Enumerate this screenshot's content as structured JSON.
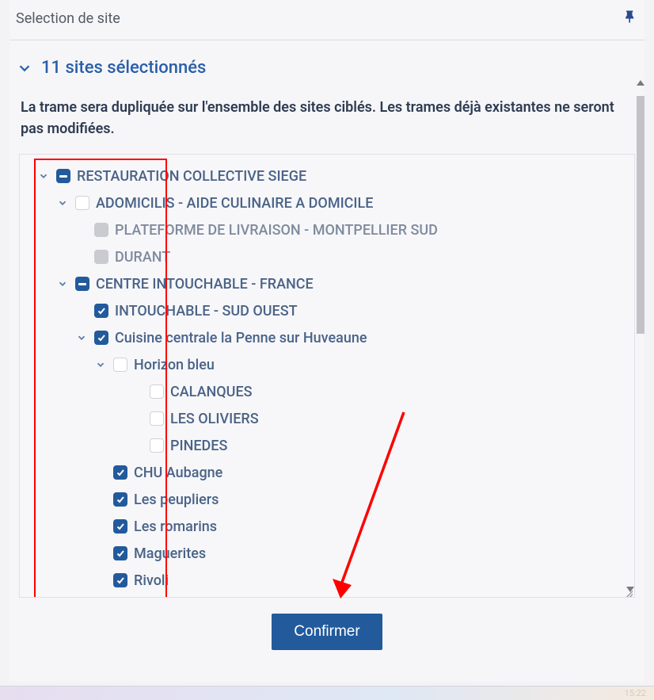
{
  "header": {
    "title": "Selection de site"
  },
  "summary": "11 sites sélectionnés",
  "description": "La trame sera dupliquée sur l'ensemble des sites ciblés. Les trames déjà existantes ne seront pas modifiées.",
  "tree": {
    "root": {
      "label": "RESTAURATION COLLECTIVE SIEGE",
      "a": {
        "label": "ADOMICILIS - AIDE CULINAIRE A DOMICILE"
      },
      "a1": {
        "label": "PLATEFORME DE LIVRAISON - MONTPELLIER SUD"
      },
      "a2": {
        "label": "DURANT"
      },
      "b": {
        "label": "CENTRE INTOUCHABLE - FRANCE"
      },
      "b1": {
        "label": "INTOUCHABLE - SUD OUEST"
      },
      "b2": {
        "label": "Cuisine centrale la Penne sur Huveaune"
      },
      "b2a": {
        "label": "Horizon bleu"
      },
      "b2a1": {
        "label": "CALANQUES"
      },
      "b2a2": {
        "label": "LES OLIVIERS"
      },
      "b2a3": {
        "label": "PINEDES"
      },
      "b2b": {
        "label": "CHU Aubagne"
      },
      "b2c": {
        "label": "Les peupliers"
      },
      "b2d": {
        "label": "Les romarins"
      },
      "b2e": {
        "label": "Maguerites"
      },
      "b2f": {
        "label": "Rivoli"
      }
    }
  },
  "confirm_label": "Confirmer",
  "footer_time": "15:22"
}
